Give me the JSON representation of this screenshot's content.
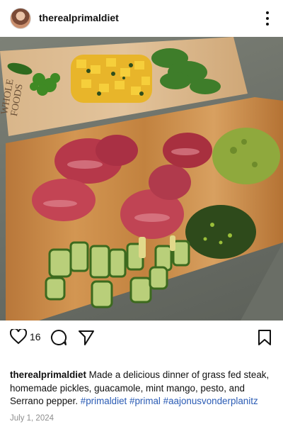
{
  "post": {
    "username": "therealprimaldiet",
    "likes": "16",
    "caption": {
      "username": "therealprimaldiet",
      "text": " Made a delicious dinner of grass fed steak, homemade pickles, guacamole, mint mango, pesto, and Serrano pepper. ",
      "hashtags": [
        "#primaldiet",
        "#primal",
        "#aajonusvonderplanitz"
      ]
    },
    "date": "July 1, 2024",
    "board_logo_text": "WHOLE FOODS MARKET"
  },
  "icons": {
    "more": "more-vertical-icon",
    "like": "heart-icon",
    "comment": "comment-icon",
    "share": "send-icon",
    "save": "bookmark-icon"
  },
  "colors": {
    "hashtag": "#2a5bb4",
    "counter": "#3b6e2a",
    "board": "#c98a4a"
  }
}
